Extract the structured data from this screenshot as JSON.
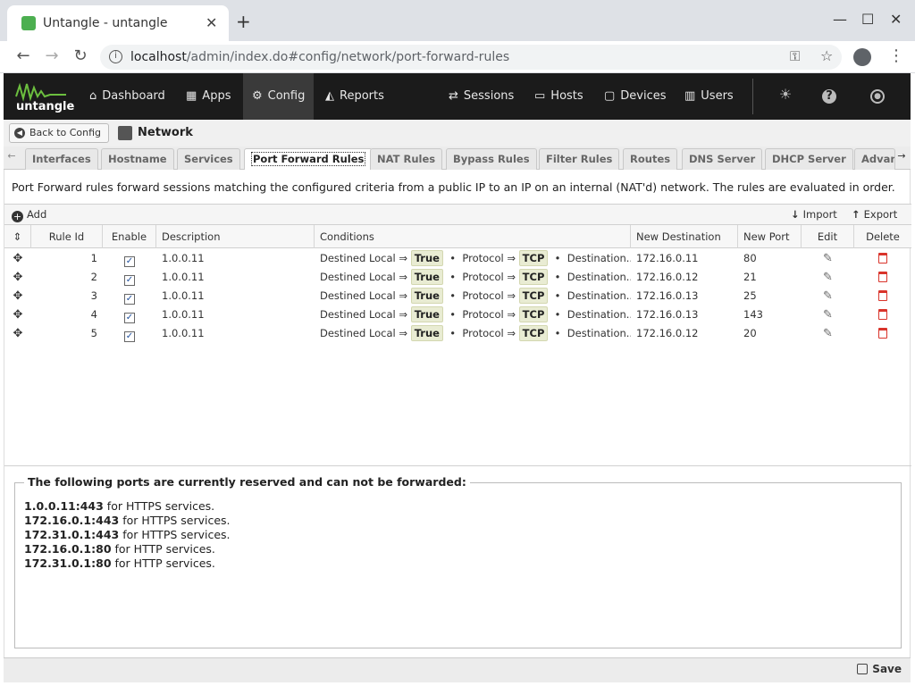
{
  "browser": {
    "tab_title": "Untangle - untangle",
    "url_host": "localhost",
    "url_path": "/admin/index.do#config/network/port-forward-rules"
  },
  "header": {
    "logo_text": "untangle",
    "nav": [
      {
        "label": "Dashboard",
        "icon": "home-icon"
      },
      {
        "label": "Apps",
        "icon": "grid-icon"
      },
      {
        "label": "Config",
        "icon": "gear-icon"
      },
      {
        "label": "Reports",
        "icon": "chart-icon"
      },
      {
        "label": "Sessions",
        "icon": "sessions-icon"
      },
      {
        "label": "Hosts",
        "icon": "hosts-icon"
      },
      {
        "label": "Devices",
        "icon": "devices-icon"
      },
      {
        "label": "Users",
        "icon": "users-icon"
      }
    ]
  },
  "breadcrumb": {
    "back_label": "Back to Config",
    "section_title": "Network"
  },
  "tabs": [
    "Interfaces",
    "Hostname",
    "Services",
    "Port Forward Rules",
    "NAT Rules",
    "Bypass Rules",
    "Filter Rules",
    "Routes",
    "DNS Server",
    "DHCP Server",
    "Advan"
  ],
  "active_tab": "Port Forward Rules",
  "description": "Port Forward rules forward sessions matching the configured criteria from a public IP to an IP on an internal (NAT'd) network. The rules are evaluated in order.",
  "toolbar": {
    "add_label": "Add",
    "import_label": "Import",
    "export_label": "Export"
  },
  "grid": {
    "columns": [
      "Rule Id",
      "Enable",
      "Description",
      "Conditions",
      "New Destination",
      "New Port",
      "Edit",
      "Delete"
    ],
    "rows": [
      {
        "rule_id": "1",
        "enabled": true,
        "description": "1.0.0.11",
        "cond1": "Destined Local ⇒",
        "val1": "True",
        "cond2": "Protocol ⇒",
        "val2": "TCP",
        "cond3": "Destination...",
        "new_dest": "172.16.0.11",
        "new_port": "80"
      },
      {
        "rule_id": "2",
        "enabled": true,
        "description": "1.0.0.11",
        "cond1": "Destined Local ⇒",
        "val1": "True",
        "cond2": "Protocol ⇒",
        "val2": "TCP",
        "cond3": "Destination...",
        "new_dest": "172.16.0.12",
        "new_port": "21"
      },
      {
        "rule_id": "3",
        "enabled": true,
        "description": "1.0.0.11",
        "cond1": "Destined Local ⇒",
        "val1": "True",
        "cond2": "Protocol ⇒",
        "val2": "TCP",
        "cond3": "Destination...",
        "new_dest": "172.16.0.13",
        "new_port": "25"
      },
      {
        "rule_id": "4",
        "enabled": true,
        "description": "1.0.0.11",
        "cond1": "Destined Local ⇒",
        "val1": "True",
        "cond2": "Protocol ⇒",
        "val2": "TCP",
        "cond3": "Destination...",
        "new_dest": "172.16.0.13",
        "new_port": "143"
      },
      {
        "rule_id": "5",
        "enabled": true,
        "description": "1.0.0.11",
        "cond1": "Destined Local ⇒",
        "val1": "True",
        "cond2": "Protocol ⇒",
        "val2": "TCP",
        "cond3": "Destination...",
        "new_dest": "172.16.0.12",
        "new_port": "20"
      }
    ]
  },
  "reserved": {
    "legend": "The following ports are currently reserved and can not be forwarded:",
    "lines": [
      {
        "addr": "1.0.0.11:443",
        "text": " for HTTPS services."
      },
      {
        "addr": "172.16.0.1:443",
        "text": " for HTTPS services."
      },
      {
        "addr": "172.31.0.1:443",
        "text": " for HTTPS services."
      },
      {
        "addr": "172.16.0.1:80",
        "text": " for HTTP services."
      },
      {
        "addr": "172.31.0.1:80",
        "text": " for HTTP services."
      }
    ]
  },
  "footer": {
    "save_label": "Save"
  }
}
